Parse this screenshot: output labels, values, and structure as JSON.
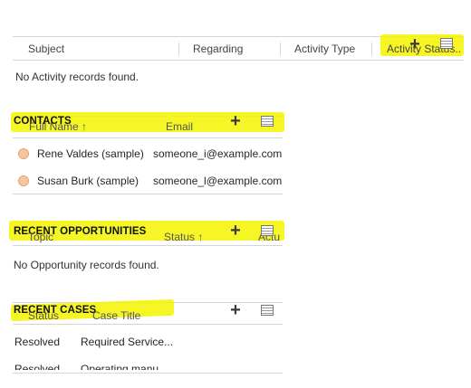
{
  "activities": {
    "columns": [
      "Subject",
      "Regarding",
      "Activity Type",
      "Activity Status.."
    ],
    "empty_message": "No Activity records found."
  },
  "contacts": {
    "title": "CONTACTS",
    "columns": [
      "Full Name ↑",
      "Email"
    ],
    "rows": [
      {
        "name": "Rene Valdes (sample)",
        "email": "someone_i@example.com"
      },
      {
        "name": "Susan Burk (sample)",
        "email": "someone_l@example.com"
      }
    ]
  },
  "opportunities": {
    "title": "RECENT OPPORTUNITIES",
    "columns": [
      "Topic",
      "Status ↑",
      "Actu"
    ],
    "empty_message": "No Opportunity records found."
  },
  "cases": {
    "title": "RECENT CASES",
    "columns": [
      "Status",
      "Case Title"
    ],
    "rows": [
      {
        "status": "Resolved",
        "title": "Required Service..."
      },
      {
        "status": "Resolved",
        "title": "Operating manu"
      }
    ]
  },
  "icons": {
    "add": "add-icon",
    "view": "grid-view-icon"
  },
  "colors": {
    "highlight": "#f4f400",
    "avatar": "#f4c7a1"
  }
}
